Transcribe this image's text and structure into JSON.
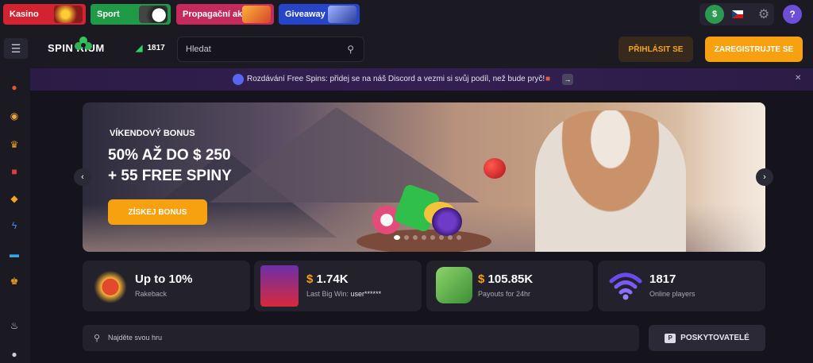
{
  "promos": [
    {
      "label": "Kasino"
    },
    {
      "label": "Sport"
    },
    {
      "label": "Propagační akce"
    },
    {
      "label": "Giveaway"
    }
  ],
  "top_icons": {
    "dollar": "$",
    "help": "?"
  },
  "header": {
    "logo": "SPIN  RIUM",
    "online_count": "1817",
    "search_placeholder": "Hledat",
    "login_label": "PŘIHLÁSIT SE",
    "register_label": "ZAREGISTRUJTE SE"
  },
  "announcement": {
    "text": "Rozdávání Free Spins: přidej se na náš Discord a vezmi si svůj podíl, než bude pryč!",
    "arrow": "→",
    "close": "✕"
  },
  "hero": {
    "subtitle": "VÍKENDOVÝ BONUS",
    "title_line1": "50% AŽ DO $ 250",
    "title_line2": "+ 55 FREE SPINY",
    "button": "ZÍSKEJ BONUS",
    "slide_count": 8,
    "active_slide": 0
  },
  "stats": [
    {
      "value": "Up to 10%",
      "label": "Rakeback"
    },
    {
      "currency": "$",
      "value": " 1.74K",
      "label": "Last Big Win:",
      "user": "user******"
    },
    {
      "currency": "$",
      "value": " 105.85K",
      "label": "Payouts for 24hr"
    },
    {
      "value": "1817",
      "label": "Online players"
    }
  ],
  "game_search": {
    "placeholder": "Najděte svou hru"
  },
  "providers_label": "POSKYTOVATELÉ",
  "colors": {
    "accent": "#f7a010",
    "online": "#2fd264",
    "discord": "#5865f2",
    "background": "#15141c",
    "card": "#22212c"
  }
}
